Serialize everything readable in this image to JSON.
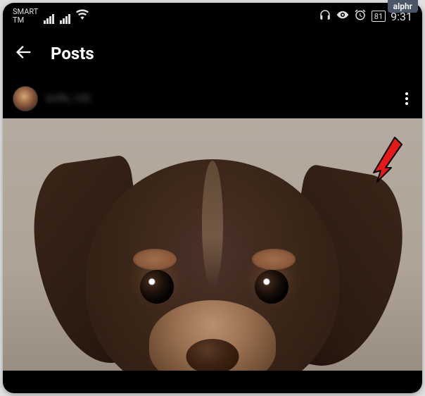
{
  "brand_badge": "alphr",
  "status_bar": {
    "carrier": "SMART\nTM",
    "battery_level": "81",
    "time": "9:31"
  },
  "header": {
    "title": "Posts"
  },
  "post": {
    "username": "koffe_145"
  },
  "icons": {
    "back": "back-arrow",
    "headphones": "headphones",
    "eye": "visibility",
    "alarm": "alarm-clock",
    "wifi": "wifi",
    "signal": "cellular-signal",
    "more": "more-vertical"
  }
}
